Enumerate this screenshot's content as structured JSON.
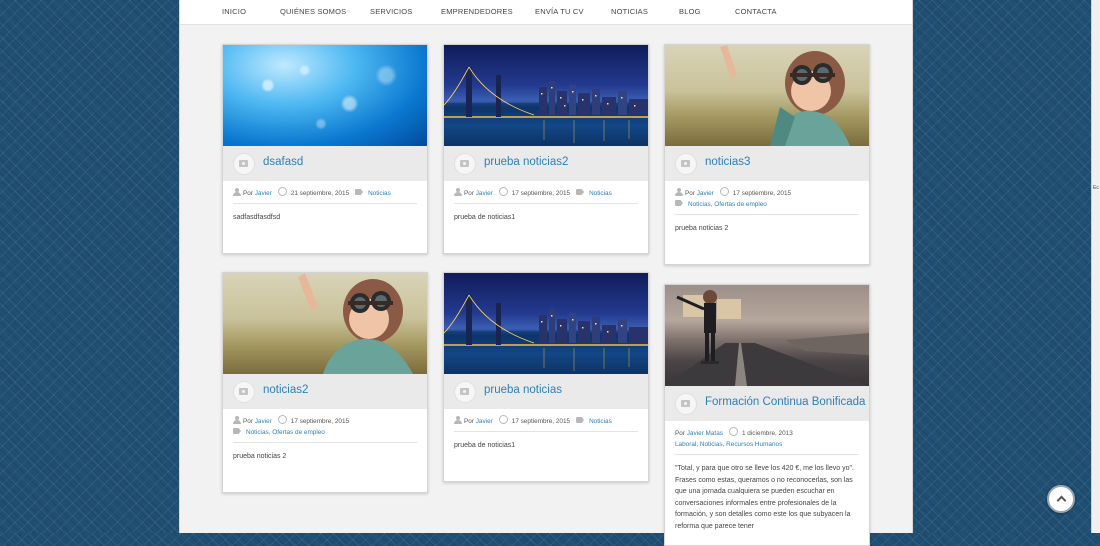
{
  "nav": {
    "items": [
      "INICIO",
      "QUIÉNES SOMOS",
      "SERVICIOS",
      "EMPRENDEDORES",
      "ENVÍA TU CV",
      "NOTICIAS",
      "BLOG",
      "CONTACTA"
    ]
  },
  "posts": [
    {
      "title": "dsafasd",
      "by": "Por",
      "author": "Javier",
      "date": "21 septiembre, 2015",
      "categories": "Noticias",
      "excerpt": "sadfasdfasdfsd",
      "image": "blue-bokeh"
    },
    {
      "title": "prueba noticias2",
      "by": "Por",
      "author": "Javier",
      "date": "17 septiembre, 2015",
      "categories": "Noticias",
      "excerpt": "prueba de noticias1",
      "image": "city-bridge-night"
    },
    {
      "title": "noticias3",
      "by": "Por",
      "author": "Javier",
      "date": "17 septiembre, 2015",
      "categories": "Noticias, Ofertas de empleo",
      "excerpt": "prueba noticias 2",
      "image": "child-aviator-goggles"
    },
    {
      "title": "noticias2",
      "by": "Por",
      "author": "Javier",
      "date": "17 septiembre, 2015",
      "categories": "Noticias, Ofertas de empleo",
      "excerpt": "prueba noticias 2",
      "image": "child-aviator-goggles"
    },
    {
      "title": "prueba noticias",
      "by": "Por",
      "author": "Javier",
      "date": "17 septiembre, 2015",
      "categories": "Noticias",
      "excerpt": "prueba de noticias1",
      "image": "city-bridge-night"
    },
    {
      "title": "Formación Continua Bonificada",
      "by": "Por",
      "author": "Javier Matas",
      "date": "1 diciembre, 2013",
      "categories": "Laboral, Noticias, Recursos Humanos",
      "excerpt": "\"Total, y para que otro se lleve los 420 €, me los llevo yo\". Frases como estas, queramos o no reconocerlas, son las que una jornada cualquiera se pueden escuchar en conversaciones informales entre profesionales de la formación, y son detalles como este los que subyacen la reforma que parece tener",
      "image": "child-cardboard-wings-road"
    }
  ],
  "side_strip_label": "Ec",
  "icons": {
    "format": "camera-icon",
    "author": "user-icon",
    "date": "clock-icon",
    "category": "tag-icon",
    "scroll_top": "chevron-up-icon"
  },
  "colors": {
    "background": "#1f4f73",
    "page": "#f2f2f2",
    "link": "#2f7fb6"
  }
}
